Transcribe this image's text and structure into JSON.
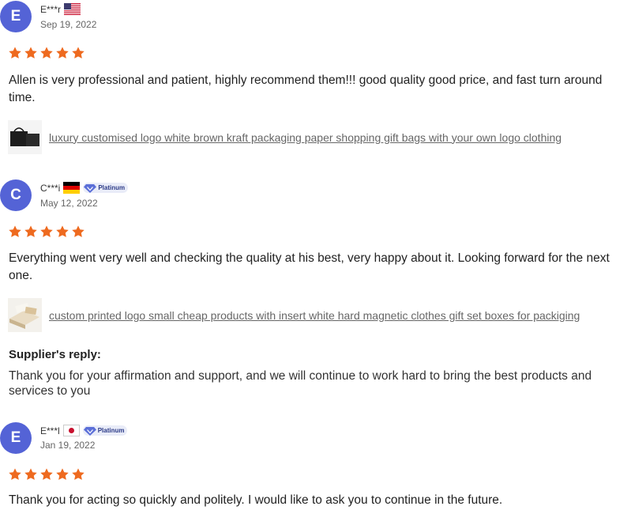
{
  "reviews": [
    {
      "avatar_letter": "E",
      "name": "E***r",
      "country": "United States",
      "date": "Sep 19, 2022",
      "rating": 5,
      "comment": "Allen is very professional and patient, highly recommend them!!! good quality good price, and fast turn around time.",
      "product_link": "luxury customised logo white brown kraft packaging paper shopping gift bags with your own logo clothing"
    },
    {
      "avatar_letter": "C",
      "name": "C***i",
      "country": "Germany",
      "badge": "Platinum",
      "date": "May 12, 2022",
      "rating": 5,
      "comment": "Everything went very well and checking the quality at his best, very happy about it. Looking forward for the next one.",
      "product_link": "custom printed logo small cheap products with insert white hard magnetic clothes gift set boxes for packiging",
      "supplier_reply_title": "Supplier's reply:",
      "supplier_reply": "Thank you for your affirmation and support, and we will continue to work hard to bring the best products and services to you"
    },
    {
      "avatar_letter": "E",
      "name": "E***l",
      "country": "Japan",
      "badge": "Platinum",
      "date": "Jan 19, 2022",
      "rating": 5,
      "comment": "Thank you for acting so quickly and politely. I would like to ask you to continue in the future."
    }
  ],
  "colors": {
    "avatar": "#5463d6",
    "star": "#ee6a1f",
    "link": "#666666"
  },
  "icons": [
    "star-icon",
    "us-flag-icon",
    "germany-flag-icon",
    "japan-flag-icon",
    "platinum-diamond-icon"
  ]
}
